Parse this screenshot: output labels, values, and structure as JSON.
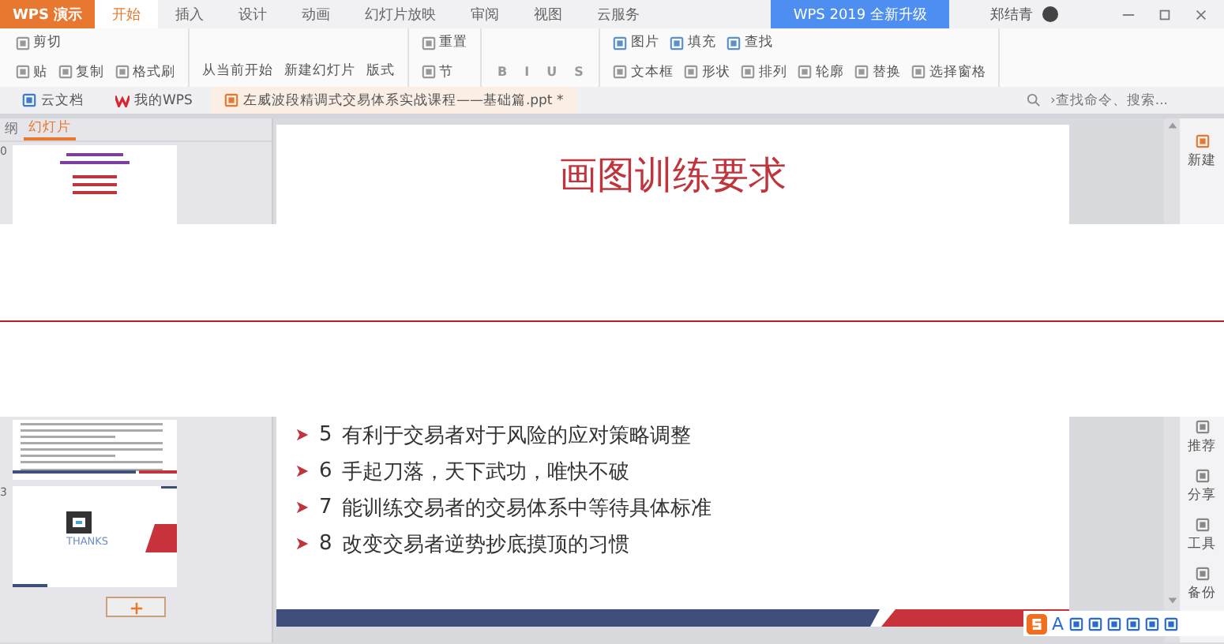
{
  "title_bar": {
    "app_menu": "WPS 演示",
    "tabs": [
      {
        "label": "开始",
        "selected": true
      },
      {
        "label": "插入",
        "selected": false
      },
      {
        "label": "设计",
        "selected": false
      },
      {
        "label": "动画",
        "selected": false
      },
      {
        "label": "幻灯片放映",
        "selected": false
      },
      {
        "label": "审阅",
        "selected": false
      },
      {
        "label": "视图",
        "selected": false
      },
      {
        "label": "云服务",
        "selected": false
      }
    ],
    "upgrade_button": "WPS 2019 全新升级",
    "user_name": "郑结青"
  },
  "ribbon": {
    "groups": [
      {
        "top": [
          "剪切"
        ],
        "bottom": [
          "贴",
          "复制",
          "格式刷"
        ]
      },
      {
        "bottom": [
          "从当前开始",
          "新建幻灯片",
          "版式"
        ]
      },
      {
        "top": [
          "重置"
        ],
        "bottom": [
          "节"
        ]
      },
      {
        "bottom": [
          "B",
          "I",
          "U",
          "S"
        ]
      },
      {
        "top": [
          "图片",
          "填充",
          "查找"
        ],
        "bottom": [
          "文本框",
          "形状",
          "排列",
          "轮廓",
          "替换",
          "选择窗格"
        ]
      }
    ]
  },
  "doc_tabs": {
    "tabs": [
      {
        "label": "云文档",
        "selected": false
      },
      {
        "label": "我的WPS",
        "selected": false
      },
      {
        "label": "左威波段精调式交易体系实战课程——基础篇.ppt *",
        "selected": true
      }
    ],
    "search": {
      "placeholder": "›查找命令、搜索..."
    }
  },
  "slides_panel": {
    "tabs": [
      {
        "label": "纲",
        "selected": false
      },
      {
        "label": "幻灯片",
        "selected": true
      }
    ],
    "upper_thumbnails": [
      {
        "number": "0",
        "kind": "list"
      }
    ],
    "lower_thumbnails": [
      {
        "kind": "text"
      },
      {
        "number": "3",
        "kind": "thanks",
        "caption": "THANKS"
      }
    ]
  },
  "slide": {
    "title": "画图训练要求",
    "bullets": [
      {
        "number": "5",
        "text": "有利于交易者对于风险的应对策略调整"
      },
      {
        "number": "6",
        "text": "手起刀落，天下武功，唯快不破"
      },
      {
        "number": "7",
        "text": "能训练交易者的交易体系中等待具体标准"
      },
      {
        "number": "8",
        "text": "改变交易者逆势抄底摸顶的习惯"
      }
    ]
  },
  "right_sidebar": {
    "upper_items": [
      "新建"
    ],
    "lower_items": [
      "推荐",
      "分享",
      "工具",
      "备份"
    ]
  },
  "ime_bar": {
    "mode": "A"
  }
}
